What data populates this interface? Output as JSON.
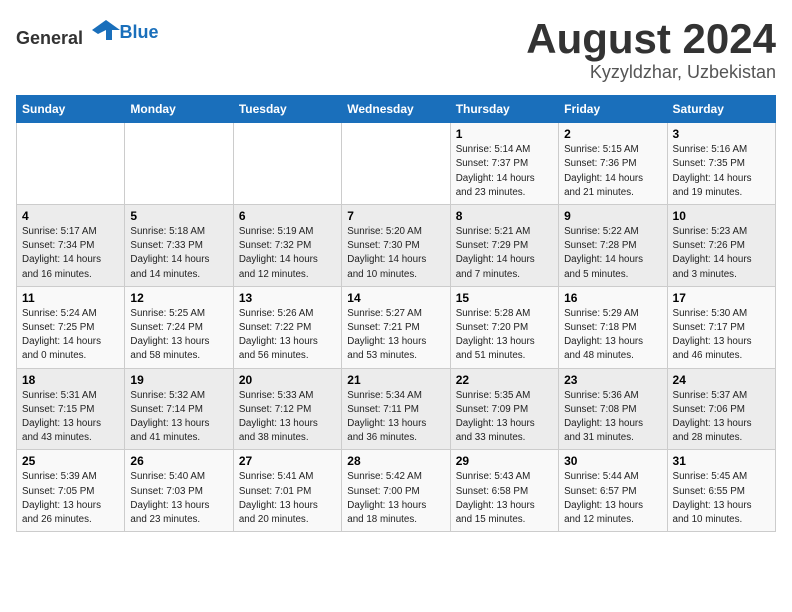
{
  "header": {
    "logo_general": "General",
    "logo_blue": "Blue",
    "month_year": "August 2024",
    "location": "Kyzyldzhar, Uzbekistan"
  },
  "weekdays": [
    "Sunday",
    "Monday",
    "Tuesday",
    "Wednesday",
    "Thursday",
    "Friday",
    "Saturday"
  ],
  "weeks": [
    [
      {
        "day": "",
        "info": ""
      },
      {
        "day": "",
        "info": ""
      },
      {
        "day": "",
        "info": ""
      },
      {
        "day": "",
        "info": ""
      },
      {
        "day": "1",
        "info": "Sunrise: 5:14 AM\nSunset: 7:37 PM\nDaylight: 14 hours\nand 23 minutes."
      },
      {
        "day": "2",
        "info": "Sunrise: 5:15 AM\nSunset: 7:36 PM\nDaylight: 14 hours\nand 21 minutes."
      },
      {
        "day": "3",
        "info": "Sunrise: 5:16 AM\nSunset: 7:35 PM\nDaylight: 14 hours\nand 19 minutes."
      }
    ],
    [
      {
        "day": "4",
        "info": "Sunrise: 5:17 AM\nSunset: 7:34 PM\nDaylight: 14 hours\nand 16 minutes."
      },
      {
        "day": "5",
        "info": "Sunrise: 5:18 AM\nSunset: 7:33 PM\nDaylight: 14 hours\nand 14 minutes."
      },
      {
        "day": "6",
        "info": "Sunrise: 5:19 AM\nSunset: 7:32 PM\nDaylight: 14 hours\nand 12 minutes."
      },
      {
        "day": "7",
        "info": "Sunrise: 5:20 AM\nSunset: 7:30 PM\nDaylight: 14 hours\nand 10 minutes."
      },
      {
        "day": "8",
        "info": "Sunrise: 5:21 AM\nSunset: 7:29 PM\nDaylight: 14 hours\nand 7 minutes."
      },
      {
        "day": "9",
        "info": "Sunrise: 5:22 AM\nSunset: 7:28 PM\nDaylight: 14 hours\nand 5 minutes."
      },
      {
        "day": "10",
        "info": "Sunrise: 5:23 AM\nSunset: 7:26 PM\nDaylight: 14 hours\nand 3 minutes."
      }
    ],
    [
      {
        "day": "11",
        "info": "Sunrise: 5:24 AM\nSunset: 7:25 PM\nDaylight: 14 hours\nand 0 minutes."
      },
      {
        "day": "12",
        "info": "Sunrise: 5:25 AM\nSunset: 7:24 PM\nDaylight: 13 hours\nand 58 minutes."
      },
      {
        "day": "13",
        "info": "Sunrise: 5:26 AM\nSunset: 7:22 PM\nDaylight: 13 hours\nand 56 minutes."
      },
      {
        "day": "14",
        "info": "Sunrise: 5:27 AM\nSunset: 7:21 PM\nDaylight: 13 hours\nand 53 minutes."
      },
      {
        "day": "15",
        "info": "Sunrise: 5:28 AM\nSunset: 7:20 PM\nDaylight: 13 hours\nand 51 minutes."
      },
      {
        "day": "16",
        "info": "Sunrise: 5:29 AM\nSunset: 7:18 PM\nDaylight: 13 hours\nand 48 minutes."
      },
      {
        "day": "17",
        "info": "Sunrise: 5:30 AM\nSunset: 7:17 PM\nDaylight: 13 hours\nand 46 minutes."
      }
    ],
    [
      {
        "day": "18",
        "info": "Sunrise: 5:31 AM\nSunset: 7:15 PM\nDaylight: 13 hours\nand 43 minutes."
      },
      {
        "day": "19",
        "info": "Sunrise: 5:32 AM\nSunset: 7:14 PM\nDaylight: 13 hours\nand 41 minutes."
      },
      {
        "day": "20",
        "info": "Sunrise: 5:33 AM\nSunset: 7:12 PM\nDaylight: 13 hours\nand 38 minutes."
      },
      {
        "day": "21",
        "info": "Sunrise: 5:34 AM\nSunset: 7:11 PM\nDaylight: 13 hours\nand 36 minutes."
      },
      {
        "day": "22",
        "info": "Sunrise: 5:35 AM\nSunset: 7:09 PM\nDaylight: 13 hours\nand 33 minutes."
      },
      {
        "day": "23",
        "info": "Sunrise: 5:36 AM\nSunset: 7:08 PM\nDaylight: 13 hours\nand 31 minutes."
      },
      {
        "day": "24",
        "info": "Sunrise: 5:37 AM\nSunset: 7:06 PM\nDaylight: 13 hours\nand 28 minutes."
      }
    ],
    [
      {
        "day": "25",
        "info": "Sunrise: 5:39 AM\nSunset: 7:05 PM\nDaylight: 13 hours\nand 26 minutes."
      },
      {
        "day": "26",
        "info": "Sunrise: 5:40 AM\nSunset: 7:03 PM\nDaylight: 13 hours\nand 23 minutes."
      },
      {
        "day": "27",
        "info": "Sunrise: 5:41 AM\nSunset: 7:01 PM\nDaylight: 13 hours\nand 20 minutes."
      },
      {
        "day": "28",
        "info": "Sunrise: 5:42 AM\nSunset: 7:00 PM\nDaylight: 13 hours\nand 18 minutes."
      },
      {
        "day": "29",
        "info": "Sunrise: 5:43 AM\nSunset: 6:58 PM\nDaylight: 13 hours\nand 15 minutes."
      },
      {
        "day": "30",
        "info": "Sunrise: 5:44 AM\nSunset: 6:57 PM\nDaylight: 13 hours\nand 12 minutes."
      },
      {
        "day": "31",
        "info": "Sunrise: 5:45 AM\nSunset: 6:55 PM\nDaylight: 13 hours\nand 10 minutes."
      }
    ]
  ]
}
